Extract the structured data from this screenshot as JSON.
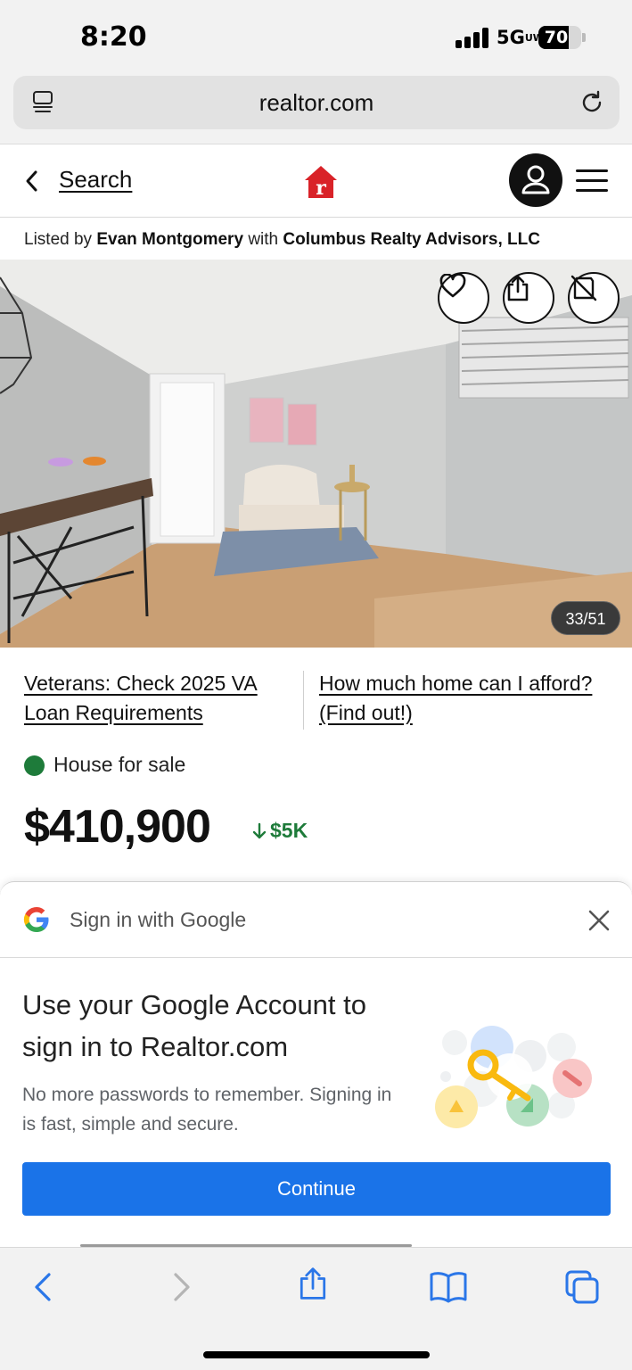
{
  "status_bar": {
    "time": "8:20",
    "network": "5G",
    "network_suffix": "UW",
    "battery": "70",
    "battery_level": 0.7
  },
  "browser": {
    "url": "realtor.com",
    "tabs_icon": "tab-overview-icon",
    "reload_icon": "reload-icon"
  },
  "header": {
    "back_label": "Search",
    "logo": "realtor-logo",
    "avatar_icon": "user-avatar-icon",
    "menu_icon": "hamburger-menu-icon"
  },
  "listing": {
    "listed_by_prefix": "Listed by",
    "agent": "Evan Montgomery",
    "with_word": "with",
    "brokerage": "Columbus Realty Advisors, LLC",
    "photo_counter": "33/51",
    "status": "House for sale",
    "status_color": "#1e7b3a",
    "price": "$410,900",
    "price_drop": "$5K"
  },
  "promos": {
    "left": "Veterans: Check 2025 VA Loan Requirements",
    "right": "How much home can I afford? (Find out!)"
  },
  "google_signin": {
    "title": "Sign in with Google",
    "heading": "Use your Google Account to sign in to Realtor.com",
    "description": "No more passwords to remember. Signing in is fast, simple and secure.",
    "continue_label": "Continue",
    "accent": "#1a73e8"
  },
  "toolbar": {
    "items": [
      "back-icon",
      "forward-icon",
      "share-icon",
      "bookmarks-icon",
      "tabs-icon"
    ]
  }
}
